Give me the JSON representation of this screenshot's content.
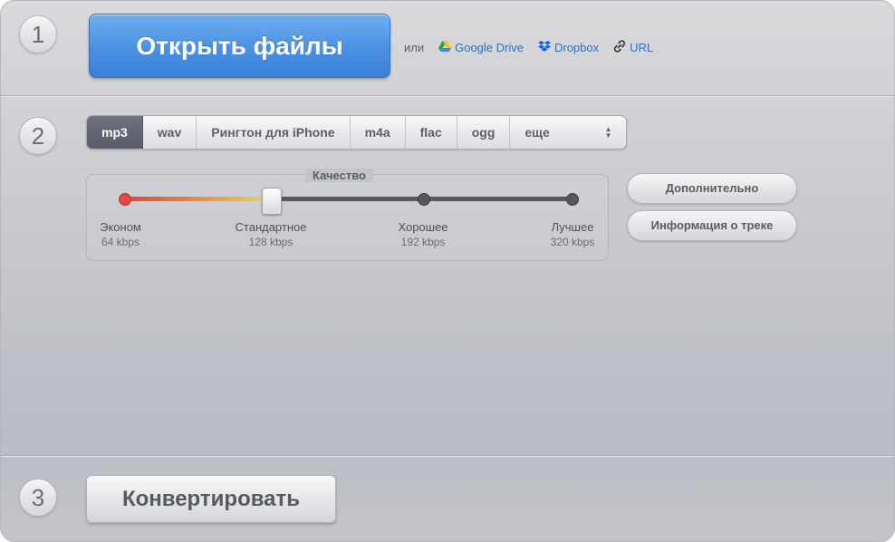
{
  "steps": [
    "1",
    "2",
    "3"
  ],
  "open": {
    "button_label": "Открыть файлы",
    "or_label": "или",
    "links": [
      {
        "label": "Google Drive",
        "icon": "google-drive-icon"
      },
      {
        "label": "Dropbox",
        "icon": "dropbox-icon"
      },
      {
        "label": "URL",
        "icon": "link-icon"
      }
    ]
  },
  "formats": {
    "tabs": [
      "mp3",
      "wav",
      "Рингтон для iPhone",
      "m4a",
      "flac",
      "ogg"
    ],
    "more_label": "еще",
    "selected": "mp3"
  },
  "quality": {
    "title": "Качество",
    "selected_index": 1,
    "levels": [
      {
        "label": "Эконом",
        "kbps": "64 kbps"
      },
      {
        "label": "Стандартное",
        "kbps": "128 kbps"
      },
      {
        "label": "Хорошее",
        "kbps": "192 kbps"
      },
      {
        "label": "Лучшее",
        "kbps": "320 kbps"
      }
    ]
  },
  "side_buttons": {
    "advanced": "Дополнительно",
    "track_info": "Информация о треке"
  },
  "convert": {
    "button_label": "Конвертировать"
  },
  "colors": {
    "accent_blue": "#4a90e2",
    "link": "#2f6fc4",
    "slider_low": "#e0423c",
    "slider_mid": "#e8c254"
  }
}
